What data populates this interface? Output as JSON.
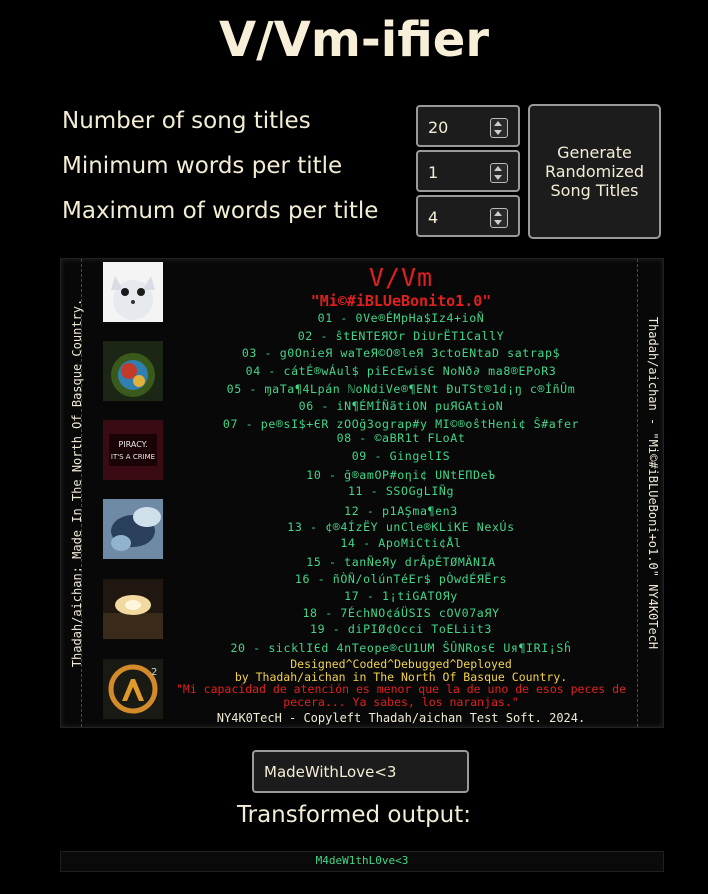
{
  "app": {
    "title": "V/Vm-ifier"
  },
  "controls": {
    "count_label": "Number of song titles",
    "count_value": "20",
    "min_label": "Minimum words per title",
    "min_value": "1",
    "max_label": "Maximum of words per title",
    "max_value": "4",
    "generate_label": "Generate Randomized Song Titles"
  },
  "cover": {
    "band": "V/Vm",
    "album": "\"Mi©#iBLUeBonito1.0\"",
    "spine_left": "Thadah/aichan: Made In The North Of Basque Country.",
    "spine_right": "Thadah/aichan - \"Mi©#iBLUeBoni+o1.0\" NY4K0TecH",
    "thumbs": [
      "white-cat-thumbnail",
      "colorful-spiral-thumbnail",
      "piracy-its-a-crime-thumbnail",
      "blue-abstract-thumbnail",
      "dark-light-thumbnail",
      "half-life-2-logo-thumbnail"
    ],
    "thumb_text": "PIRACY IT'S A CRIME",
    "tracks": [
      "01 - 0Ve®ÉMpHa$Iz4+ioÑ",
      "02 - ŝtENTEЯ℧r DiUrËT1CallY",
      "03 - g0OnieЯ waTeЯ©O®leЯ 3ctoENtaD satrap$",
      "04 - cátÉ®wÁul$ piEcEwisЄ NoNð∂ ma8®EPoR3",
      "05 - ɱaTa¶4Lpán ℕoNdiVe®¶ENt ĐuTSt®1d¡ŋ c®ÍñÛm",
      "06 - iN¶ÉMÍÑãtiON puЯGAtioN",
      "07 - pe®sI$+ЄR zOOğ3ograp#y MI©®oŝtHeni¢ Ŝ#afer",
      "08 - ©aBR1t FLoAt",
      "09 - GingelIS",
      "10 - ğ®amOP#oηi¢ UNtEΠDeЪ",
      "11 - SSOGgLIÑg",
      "12 - p1AŞma¶en3",
      "13 - ¢®4ÍzËY unCle®KLiKE NexÚs",
      "14 - ApoMiCti¢Ål",
      "15 - tanÑeЯy drÂpÉTØMÄNIA",
      "16 - ñÒÑ/olúnTéЕr$ pÒwdÉЯËrs",
      "17 - 1¡tiGATOЯy",
      "18 - 7ÉchNO¢áÜSIS cOV07aЯY",
      "19 - diPIØ¢Occi ToELiit3",
      "20 - sicklIЄd 4nTeope®cU1UM ŜÛNRosЄ Uя¶IRI¡Sĥ"
    ],
    "credit_line1": "Designed^Coded^Debugged^Deployed",
    "credit_line2": "by Thadah/aichan in The North Of Basque Country.",
    "quote": "\"Mi capacidad de atención es menor que la de uno de esos peces de pecera... Ya sabes, los naranjas.\"",
    "copyright": "NY4K0TecH - Copyleft Thadah/aichan Test Soft. 2024."
  },
  "input": {
    "value": "MadeWithLove<3"
  },
  "output": {
    "label": "Transformed output:",
    "value": "M4deW1thL0ve<3"
  },
  "colors": {
    "background": "#000000",
    "text": "#f4edd6",
    "red": "#e02020",
    "green": "#41d68a",
    "yellow": "#f1d24a"
  }
}
